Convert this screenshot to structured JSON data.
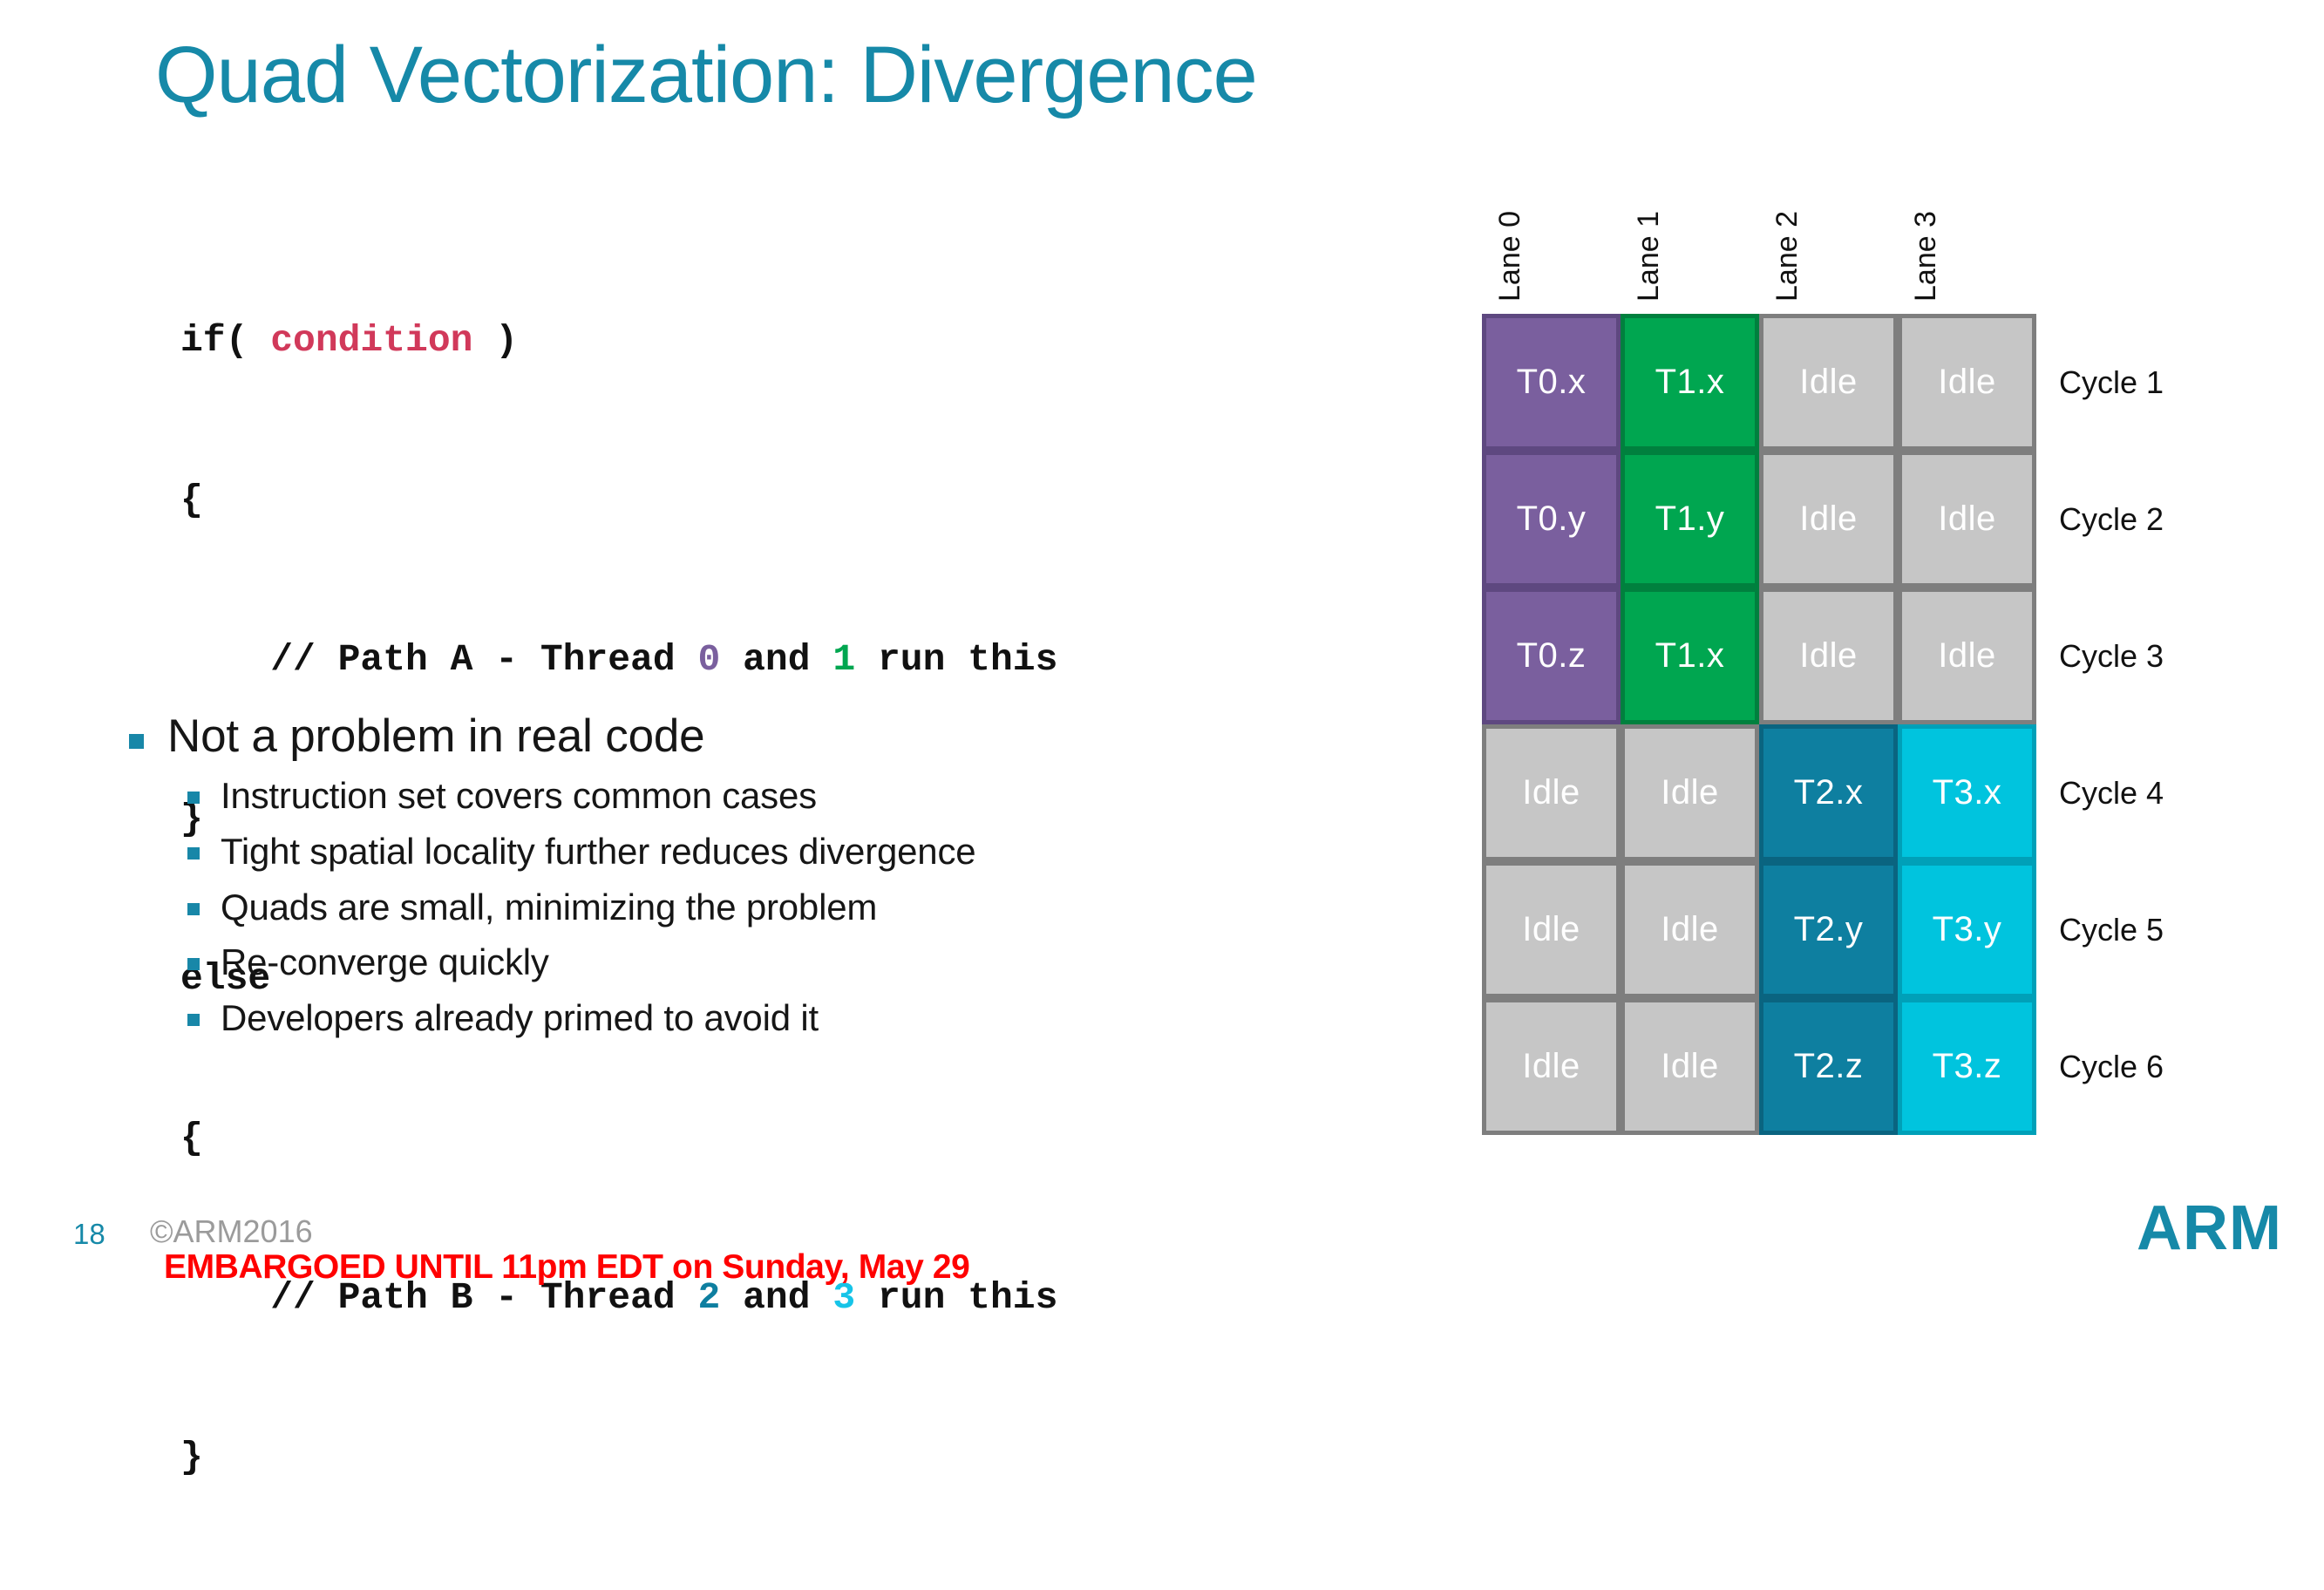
{
  "slide": {
    "title": "Quad Vectorization: Divergence",
    "page_number": "18",
    "copyright": "©ARM2016",
    "embargo_notice": "EMBARGOED UNTIL 11pm EDT on Sunday, May 29",
    "logo": "ARM"
  },
  "colors": {
    "title_teal": "#1689A8",
    "bullet_teal": "#1887A8",
    "code_condition_red": "#D1395A",
    "thread0_purple": "#7A5F9E",
    "thread1_green": "#00A650",
    "thread2_dark_teal": "#0E7FA0",
    "thread3_cyan": "#00C4DE",
    "idle_gray": "#C6C6C6",
    "embargo_red": "#FF0000"
  },
  "code": {
    "line1_a": "if( ",
    "line1_cond": "condition",
    "line1_b": " )",
    "line2": "{",
    "line3_a": "    // Path A - Thread ",
    "line3_t0": "0",
    "line3_b": " and ",
    "line3_t1": "1",
    "line3_c": " run this",
    "line4": "}",
    "line5": "else",
    "line6": "{",
    "line7_a": "    // Path B - Thread ",
    "line7_t2": "2",
    "line7_b": " and ",
    "line7_t3": "3",
    "line7_c": " run this",
    "line8": "}"
  },
  "bullets": {
    "main": "Not a problem in real code",
    "sub": [
      "Instruction set covers common cases",
      "Tight spatial locality further reduces divergence",
      "Quads are small, minimizing the problem",
      "Re-converge quickly",
      "Developers already primed to avoid it"
    ]
  },
  "diagram": {
    "lane_headers": [
      "Lane 0",
      "Lane 1",
      "Lane 2",
      "Lane 3"
    ],
    "cycle_labels": [
      "Cycle 1",
      "Cycle 2",
      "Cycle 3",
      "Cycle 4",
      "Cycle 5",
      "Cycle 6"
    ],
    "rows": [
      [
        {
          "label": "T0.x",
          "kind": "t0"
        },
        {
          "label": "T1.x",
          "kind": "t1"
        },
        {
          "label": "Idle",
          "kind": "idle"
        },
        {
          "label": "Idle",
          "kind": "idle"
        }
      ],
      [
        {
          "label": "T0.y",
          "kind": "t0"
        },
        {
          "label": "T1.y",
          "kind": "t1"
        },
        {
          "label": "Idle",
          "kind": "idle"
        },
        {
          "label": "Idle",
          "kind": "idle"
        }
      ],
      [
        {
          "label": "T0.z",
          "kind": "t0"
        },
        {
          "label": "T1.x",
          "kind": "t1"
        },
        {
          "label": "Idle",
          "kind": "idle"
        },
        {
          "label": "Idle",
          "kind": "idle"
        }
      ],
      [
        {
          "label": "Idle",
          "kind": "idle"
        },
        {
          "label": "Idle",
          "kind": "idle"
        },
        {
          "label": "T2.x",
          "kind": "t2"
        },
        {
          "label": "T3.x",
          "kind": "t3"
        }
      ],
      [
        {
          "label": "Idle",
          "kind": "idle"
        },
        {
          "label": "Idle",
          "kind": "idle"
        },
        {
          "label": "T2.y",
          "kind": "t2"
        },
        {
          "label": "T3.y",
          "kind": "t3"
        }
      ],
      [
        {
          "label": "Idle",
          "kind": "idle"
        },
        {
          "label": "Idle",
          "kind": "idle"
        },
        {
          "label": "T2.z",
          "kind": "t2"
        },
        {
          "label": "T3.z",
          "kind": "t3"
        }
      ]
    ]
  }
}
